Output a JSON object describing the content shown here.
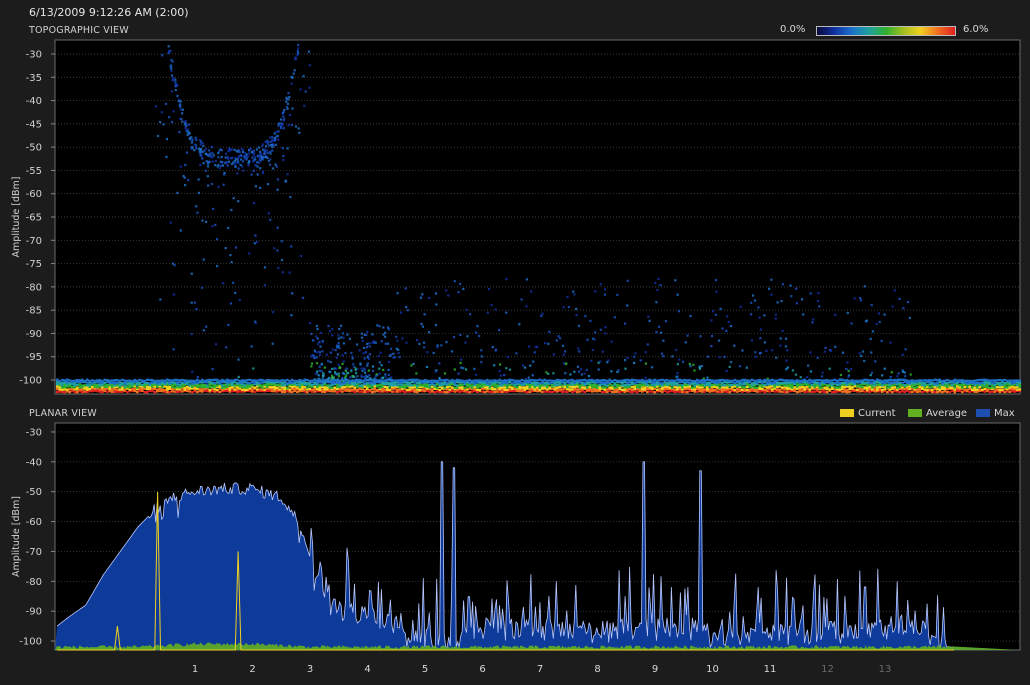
{
  "header": {
    "timestamp": "6/13/2009 9:12:26 AM (2:00)"
  },
  "topographic": {
    "title": "TOPOGRAPHIC VIEW",
    "scale_min": "0.0%",
    "scale_max": "6.0%",
    "ylabel": "Amplitude [dBm]",
    "yticks": [
      "-30",
      "-35",
      "-40",
      "-45",
      "-50",
      "-55",
      "-60",
      "-65",
      "-70",
      "-75",
      "-80",
      "-85",
      "-90",
      "-95",
      "-100"
    ]
  },
  "planar": {
    "title": "PLANAR VIEW",
    "ylabel": "Amplitude [dBm]",
    "yticks": [
      "-30",
      "-40",
      "-50",
      "-60",
      "-70",
      "-80",
      "-90",
      "-100"
    ],
    "legend": [
      {
        "label": "Current",
        "color": "#f0d020"
      },
      {
        "label": "Average",
        "color": "#60b020"
      },
      {
        "label": "Max",
        "color": "#1c4fb0"
      }
    ]
  },
  "x_channels": [
    {
      "label": "1",
      "active": true
    },
    {
      "label": "2",
      "active": true
    },
    {
      "label": "3",
      "active": true
    },
    {
      "label": "4",
      "active": true
    },
    {
      "label": "5",
      "active": true
    },
    {
      "label": "6",
      "active": true
    },
    {
      "label": "7",
      "active": true
    },
    {
      "label": "8",
      "active": true
    },
    {
      "label": "9",
      "active": true
    },
    {
      "label": "10",
      "active": true
    },
    {
      "label": "11",
      "active": true
    },
    {
      "label": "12",
      "active": false
    },
    {
      "label": "13",
      "active": false
    }
  ],
  "colors": {
    "max_fill": "#0e3a9a",
    "max_line": "#b8c8ff",
    "current": "#f0d020",
    "average": "#60b020",
    "grid": "#505050"
  },
  "chart_data": [
    {
      "type": "heatmap",
      "title": "TOPOGRAPHIC VIEW",
      "ylabel": "Amplitude [dBm]",
      "ylim": [
        -103,
        -27
      ],
      "x_channels": [
        "1",
        "2",
        "3",
        "4",
        "5",
        "6",
        "7",
        "8",
        "9",
        "10",
        "11",
        "12",
        "13"
      ],
      "color_scale": [
        "0.0%",
        "6.0%"
      ],
      "clusters": [
        {
          "channel_from": 0.3,
          "channel_to": 3.0,
          "amplitude_from": -100,
          "amplitude_to": -48
        },
        {
          "channel_from": 3.0,
          "channel_to": 4.5,
          "amplitude_from": -100,
          "amplitude_to": -88
        },
        {
          "channel_from": 4.5,
          "channel_to": 13.5,
          "amplitude_from": -103,
          "amplitude_to": -78
        }
      ],
      "floor_band_dbm": -101
    },
    {
      "type": "line",
      "title": "PLANAR VIEW",
      "ylabel": "Amplitude [dBm]",
      "ylim": [
        -103,
        -27
      ],
      "x_channels": [
        "1",
        "2",
        "3",
        "4",
        "5",
        "6",
        "7",
        "8",
        "9",
        "10",
        "11",
        "12",
        "13"
      ],
      "series": [
        {
          "name": "Max",
          "points": [
            [
              -1.4,
              -95
            ],
            [
              -1.2,
              -92
            ],
            [
              -0.9,
              -88
            ],
            [
              -0.6,
              -78
            ],
            [
              -0.3,
              -70
            ],
            [
              0.0,
              -62
            ],
            [
              0.3,
              -56
            ],
            [
              0.6,
              -52
            ],
            [
              1.0,
              -50
            ],
            [
              1.5,
              -49
            ],
            [
              2.0,
              -49
            ],
            [
              2.5,
              -52
            ],
            [
              2.8,
              -60
            ],
            [
              3.0,
              -72
            ],
            [
              3.2,
              -82
            ],
            [
              3.5,
              -86
            ],
            [
              4.0,
              -88
            ],
            [
              4.4,
              -90
            ],
            [
              4.7,
              -95
            ],
            [
              5.2,
              -96
            ],
            [
              5.3,
              -40
            ],
            [
              5.4,
              -98
            ],
            [
              5.5,
              -42
            ],
            [
              5.7,
              -95
            ],
            [
              6.0,
              -92
            ],
            [
              7.0,
              -92
            ],
            [
              8.0,
              -93
            ],
            [
              8.8,
              -92
            ],
            [
              8.8,
              -40
            ],
            [
              9.0,
              -92
            ],
            [
              9.8,
              -92
            ],
            [
              9.8,
              -43
            ],
            [
              10.0,
              -95
            ],
            [
              11.0,
              -94
            ],
            [
              12.0,
              -93
            ],
            [
              13.0,
              -92
            ],
            [
              13.5,
              -90
            ],
            [
              14.2,
              -100
            ]
          ]
        },
        {
          "name": "Average",
          "points": [
            [
              -1.4,
              -102
            ],
            [
              0.0,
              -102
            ],
            [
              1.0,
              -101
            ],
            [
              2.0,
              -101
            ],
            [
              3.0,
              -102
            ],
            [
              5.0,
              -102
            ],
            [
              7.0,
              -102
            ],
            [
              9.0,
              -102
            ],
            [
              11.0,
              -102
            ],
            [
              13.0,
              -102
            ],
            [
              14.2,
              -102
            ]
          ]
        },
        {
          "name": "Current",
          "points": [
            [
              -1.4,
              -103
            ],
            [
              -0.4,
              -103
            ],
            [
              -0.35,
              -95
            ],
            [
              -0.3,
              -103
            ],
            [
              0.3,
              -103
            ],
            [
              0.35,
              -50
            ],
            [
              0.4,
              -103
            ],
            [
              1.7,
              -103
            ],
            [
              1.75,
              -70
            ],
            [
              1.8,
              -103
            ],
            [
              14.2,
              -103
            ]
          ]
        }
      ]
    }
  ]
}
